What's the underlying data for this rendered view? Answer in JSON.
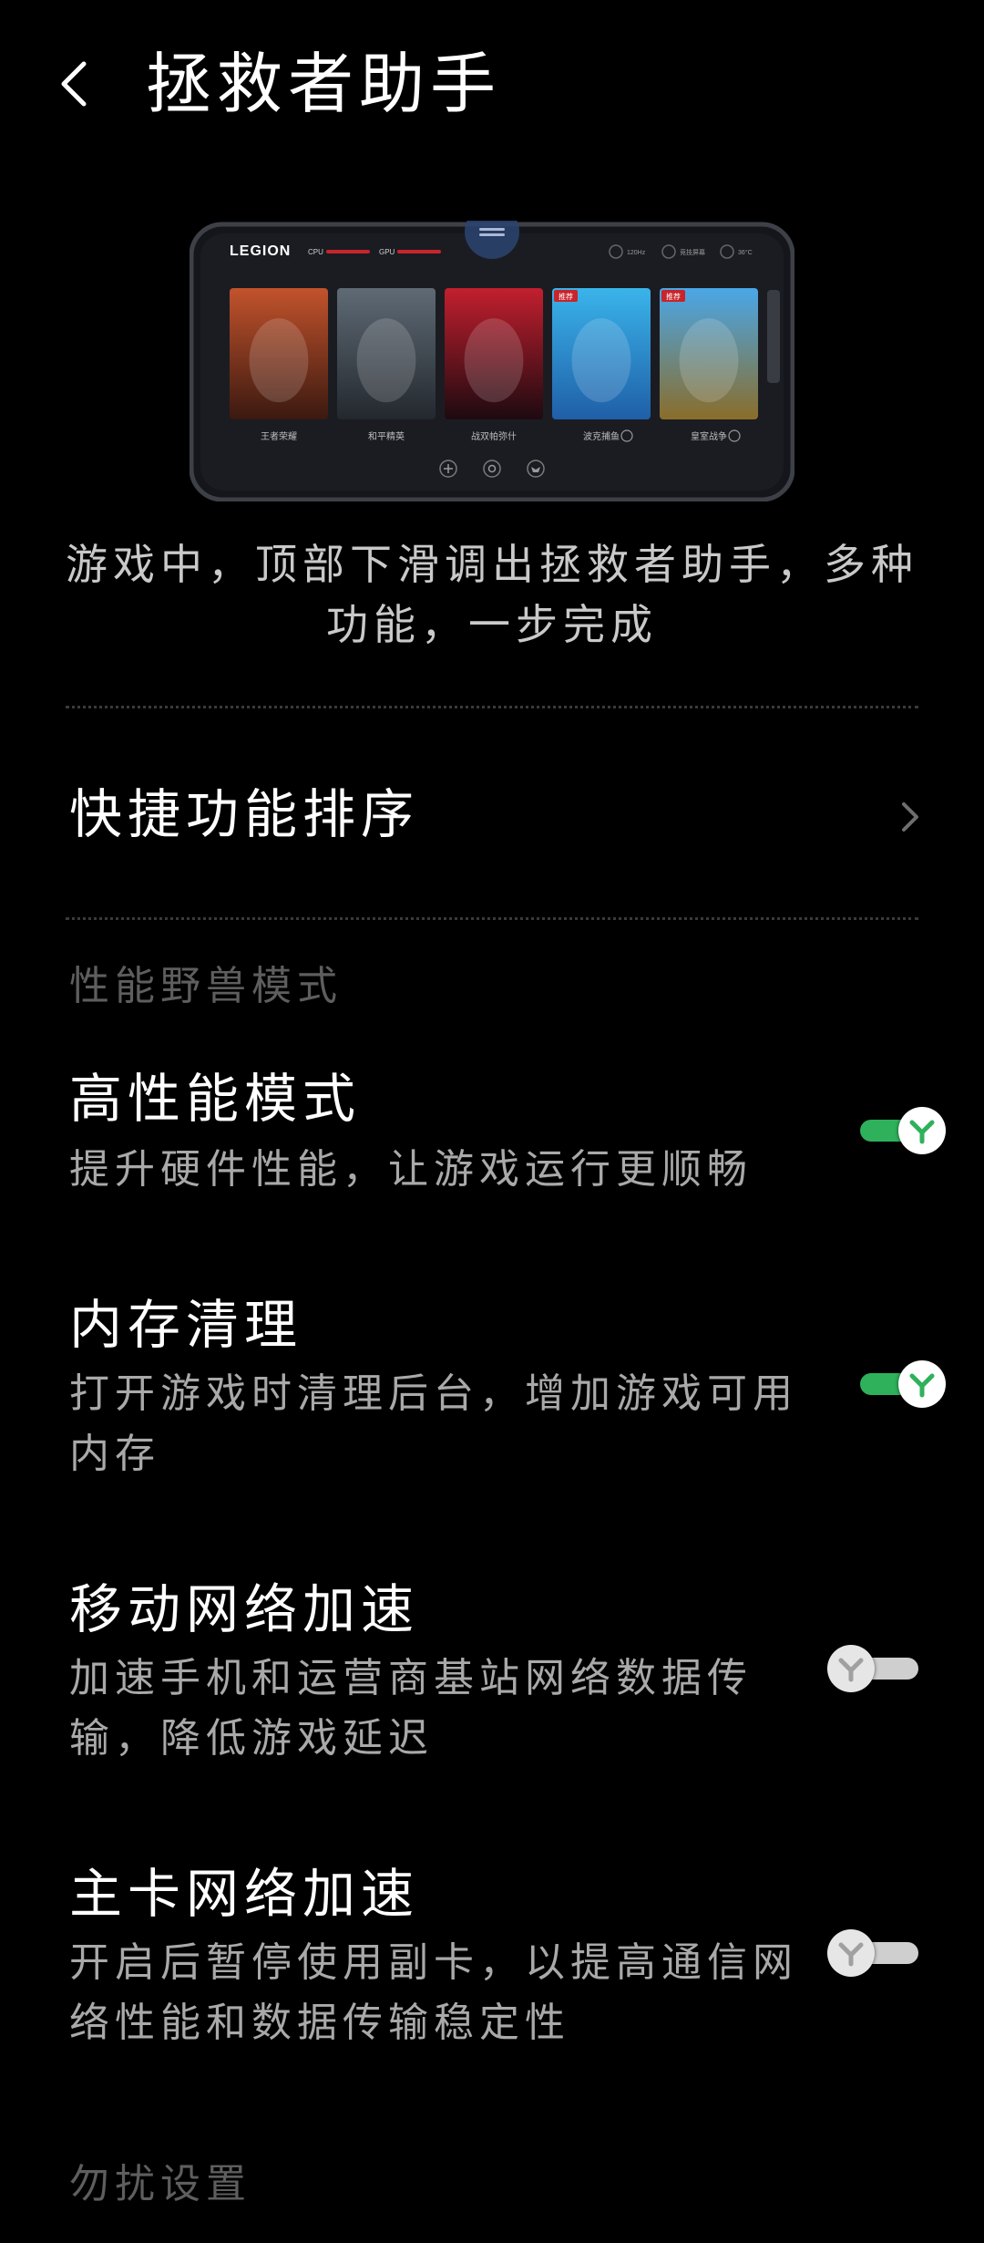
{
  "header": {
    "title": "拯救者助手"
  },
  "preview": {
    "logo": "LEGION",
    "labels": [
      "CPU",
      "GPU"
    ],
    "status": [
      "120Hz",
      "竞技屏幕",
      "36°C"
    ],
    "badges": [
      "推荐",
      "推荐"
    ],
    "games": [
      {
        "name": "王者荣耀",
        "colors": [
          "#c2532c",
          "#3b1910"
        ]
      },
      {
        "name": "和平精英",
        "colors": [
          "#5f6a75",
          "#23282e"
        ]
      },
      {
        "name": "战双帕弥什",
        "colors": [
          "#c21f2e",
          "#1d0a10"
        ]
      },
      {
        "name": "波克捕鱼",
        "colors": [
          "#3ab4ea",
          "#1f5fa8"
        ]
      },
      {
        "name": "皇室战争",
        "colors": [
          "#4aa7e8",
          "#8a6d2a"
        ]
      }
    ]
  },
  "intro": {
    "line1": "游戏中，顶部下滑调出拯救者助手，多种",
    "line2": "功能，一步完成"
  },
  "quick_sort": {
    "label": "快捷功能排序"
  },
  "section_performance": "性能野兽模式",
  "settings": [
    {
      "title": "高性能模式",
      "sub1": "提升硬件性能，让游戏运行更顺畅",
      "sub2": "",
      "enabled": true
    },
    {
      "title": "内存清理",
      "sub1": "打开游戏时清理后台，增加游戏可用",
      "sub2": "内存",
      "enabled": true
    },
    {
      "title": "移动网络加速",
      "sub1": "加速手机和运营商基站网络数据传",
      "sub2": "输，降低游戏延迟",
      "enabled": false
    },
    {
      "title": "主卡网络加速",
      "sub1": "开启后暂停使用副卡，以提高通信网",
      "sub2": "络性能和数据传输稳定性",
      "enabled": false
    }
  ],
  "section_dnd": "勿扰设置",
  "colors": {
    "accent": "#2fb15b",
    "legion_red": "#c8242b"
  }
}
